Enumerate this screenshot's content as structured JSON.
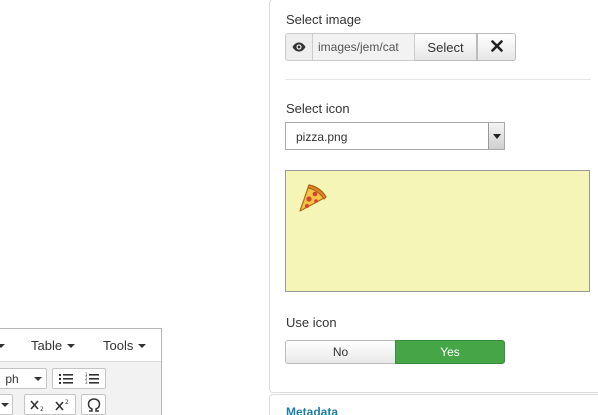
{
  "image_field": {
    "label": "Select image",
    "value": "images/jem/cat",
    "select_label": "Select"
  },
  "icon_field": {
    "label": "Select icon",
    "selected": "pizza.png"
  },
  "use_icon": {
    "label": "Use icon",
    "no_label": "No",
    "yes_label": "Yes",
    "value": "Yes"
  },
  "metadata": {
    "title": "Metadata"
  },
  "editor": {
    "menu_table": "Table",
    "menu_tools": "Tools",
    "format_value": "ph"
  },
  "colors": {
    "preview_bg": "#f5f5b8",
    "yes_active": "#46a546",
    "metadata_link": "#1f7ea6"
  },
  "icons": [
    "eye-icon",
    "close-icon",
    "pizza-icon",
    "bullet-list-icon",
    "numbered-list-icon",
    "subscript-icon",
    "superscript-icon",
    "omega-icon"
  ]
}
